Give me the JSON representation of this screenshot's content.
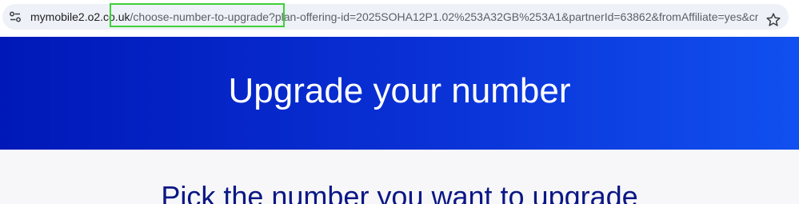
{
  "browser": {
    "url_host": "mymobile2.o2.co.uk",
    "url_path": "/choose-number-to-upgrade?plan-offering-id=2025SOHA12P1.02%253A32GB%253A1&partnerId=63862&fromAffiliate=yes&cm_...",
    "site_info_icon": "tune-icon",
    "bookmark_icon": "star-icon",
    "highlight_color": "#3fd03a"
  },
  "hero": {
    "title": "Upgrade your number",
    "background_color": "#0a32d6"
  },
  "main": {
    "heading": "Pick the number you want to upgrade",
    "heading_color": "#0b1784"
  }
}
